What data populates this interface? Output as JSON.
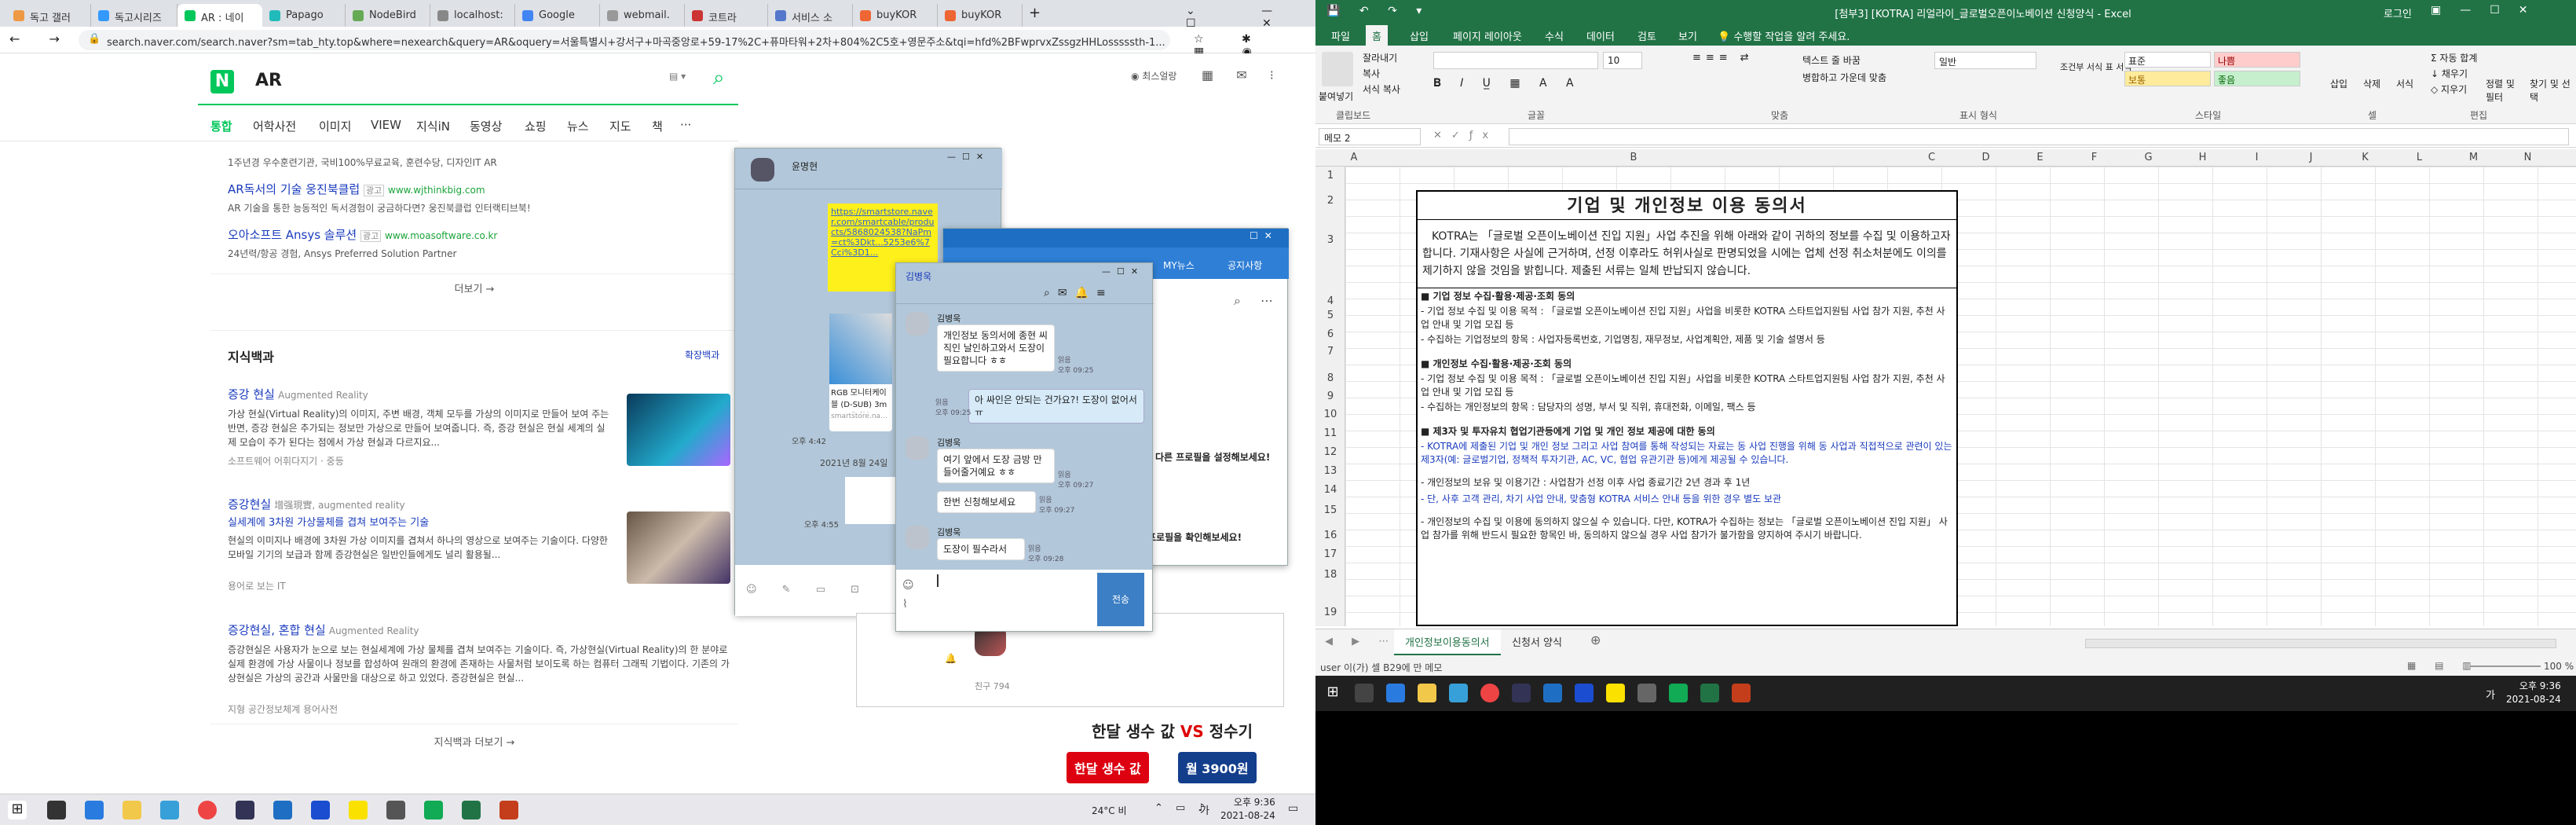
{
  "browser": {
    "tabs": [
      "독고 갤러",
      "독고시리즈",
      "AR : 네이",
      "Papago",
      "NodeBird",
      "localhost:",
      "Google",
      "webmail.",
      "코트라",
      "서비스 소",
      "buyKOR",
      "buyKOR"
    ],
    "url": "search.naver.com/search.naver?sm=tab_hty.top&where=nexearch&query=AR&oquery=서울특별시+강서구+마곡중앙로+59-17%2C+퓨마타워+2차+804%2C5호+영문주소&tqi=hfd%2BFwprvxZssgzHHLosssssth-1..."
  },
  "naver": {
    "logo": "N",
    "query": "AR",
    "user": "최스얼랑",
    "tabs": [
      "통합",
      "어학사전",
      "이미지",
      "VIEW",
      "지식iN",
      "동영상",
      "쇼핑",
      "뉴스",
      "지도",
      "책",
      "···"
    ],
    "ad_top": "1주년경 우수훈련기관, 국비100%무료교육, 훈련수당, 디자인IT AR",
    "ads": [
      {
        "title": "AR독서의 기술 웅진북클럽",
        "badge": "광고",
        "url": "www.wjthinkbig.com",
        "desc": "AR 기술을 통한 능동적인 독서경험이 궁금하다면? 웅진북클럽 인터랙티브북!"
      },
      {
        "title": "오아소프트 Ansys 솔루션",
        "badge": "광고",
        "url": "www.moasoftware.co.kr",
        "desc": "24년력/항공 경험, Ansys Preferred Solution Partner"
      }
    ],
    "more1": "더보기 →",
    "kb_title": "지식백과",
    "kb_expand": "확장백과",
    "kb": [
      {
        "title": "증강 현실",
        "en": "Augmented Reality",
        "text": "가상 현실(Virtual Reality)의 이미지, 주변 배경, 객체 모두를 가상의 이미지로 만들어 보여 주는 반면, 증강 현실은 추가되는 정보만 가상으로 만들어 보여줍니다. 즉, 증강 현실은 현실 세계의 실제 모습이 주가 된다는 점에서 가상 현실과 다르지요...",
        "src": "소프트웨어 어휘다지기 · 중등"
      },
      {
        "title": "증강현실",
        "en": "增强現實, augmented reality",
        "sub": "실세계에 3차원 가상물체를 겹쳐 보여주는 기술",
        "text": "현실의 이미지나 배경에 3차원 가상 이미지를 겹쳐서 하나의 영상으로 보여주는 기술이다. 다양한 모바일 기기의 보급과 함께 증강현실은 일반인들에게도 널리 활용될...",
        "src": "용어로 보는 IT"
      },
      {
        "title": "증강현실, 혼합 현실",
        "en": "Augmented Reality",
        "text": "증강현실은 사용자가 눈으로 보는 현실세계에 가상 물체를 겹쳐 보여주는 기술이다. 즉, 가상현실(Virtual Reality)의 한 분야로 실제 환경에 가상 사물이나 정보를 합성하여 원래의 환경에 존재하는 사물처럼 보이도록 하는 컴퓨터 그래픽 기법이다. 기존의 가상현실은 가상의 공간과 사물만을 대상으로 하고 있었다. 증강현실은 현실...",
        "src": "지형 공간정보체계 용어사전"
      }
    ],
    "more2": "지식백과 더보기 →",
    "ad_banner": {
      "title_a": "한달 생수 값",
      "vs": "VS",
      "title_b": "정수기",
      "btn1": "한달 생수 값",
      "btn2": "월 3900원"
    }
  },
  "kakao_bg": {
    "name": "윤명현",
    "link": "https://smartstore.naver.com/smartcable/products/5868024538?NaPm=ct%3Dkt...5253e6%7Cci%3D1...",
    "t1": "오후 4:42",
    "date": "2021년 8월 24일",
    "t2": "오후 4:55",
    "card": "RGB 모니터케이블 (D-SUB) 3m RGB케이블",
    "card2": "smartstore.naver.com"
  },
  "kakao": {
    "name": "김병욱",
    "msgs": [
      {
        "sender": "김병욱",
        "text": "개인정보 동의서에 종현 씨 직인 날인하고와서 도장이 필요합니다 ㅎㅎ",
        "side": "left",
        "read": "읽음",
        "time": "오후 09:25"
      },
      {
        "text": "아 싸인은 안되는 건가요?! 도장이 없어서 ㅠ",
        "side": "right",
        "read": "읽음",
        "time": "오후 09:25"
      },
      {
        "sender": "김병욱",
        "text": "여기 앞에서 도장 금방 만들어줄거예요 ㅎㅎ",
        "side": "left",
        "read": "읽음",
        "time": "오후 09:27"
      },
      {
        "text": "한번 신청해보세요",
        "side": "left",
        "read": "읽음",
        "time": "오후 09:27"
      },
      {
        "sender": "김병욱",
        "text": "도장이 필수라서",
        "side": "left",
        "read": "읽음",
        "time": "오후 09:28"
      }
    ],
    "send": "전송"
  },
  "kakao_list": {
    "title": "MY뉴스",
    "notice": "공지사항",
    "p1": "다른 프로필을 설정해보세요!",
    "p2": "프로필을 확인해보세요!",
    "friend": "친구 794"
  },
  "tray_left": {
    "weather": "24°C 비",
    "ime": "가",
    "time": "오후 9:36",
    "date": "2021-08-24"
  },
  "excel": {
    "title": "[첨부3] [KOTRA] 리얼라이_글로벌오픈이노베이션 신청양식 - Excel",
    "user": "로그인",
    "tabs": [
      "파일",
      "홈",
      "삽입",
      "페이지 레이아웃",
      "수식",
      "데이터",
      "검토",
      "보기",
      "수행할 작업을 알려 주세요."
    ],
    "namebox": "메모 2",
    "font_size": "10",
    "groups": [
      "클립보드",
      "글꼴",
      "맞춤",
      "표시 형식",
      "스타일",
      "셀",
      "편집"
    ],
    "ribbon_btns": [
      "붙여넣기",
      "잘라내기",
      "복사",
      "서식 복사",
      "텍스트 줄 바꿈",
      "병합하고 가운데 맞춤",
      "일반",
      "조건부 서식",
      "표 서식",
      "표준",
      "나쁨",
      "보통",
      "좋음",
      "삽입",
      "삭제",
      "서식",
      "자동 합계",
      "채우기",
      "지우기",
      "정렬 및 필터",
      "찾기 및 선택"
    ],
    "cols": [
      "A",
      "B",
      "C",
      "D",
      "E",
      "F",
      "G",
      "H",
      "I",
      "J",
      "K",
      "L",
      "M",
      "N"
    ],
    "rows": [
      "1",
      "2",
      "3",
      "4",
      "5",
      "6",
      "7",
      "8",
      "9",
      "10",
      "11",
      "12",
      "13",
      "14",
      "15",
      "16",
      "17",
      "18",
      "19"
    ],
    "doc": {
      "title": "기업 및 개인정보 이용 동의서",
      "intro": "KOTRA는 「글로벌 오픈이노베이션 진입 지원」사업 추진을 위해 아래와 같이 귀하의 정보를 수집 및 이용하고자 합니다. 기재사항은 사실에 근거하며, 선정 이후라도 허위사실로 판명되었을 시에는 업체 선정 취소처분에도 이의를 제기하지 않을 것임을 밝힙니다. 제출된 서류는 일체 반납되지 않습니다.",
      "s1": "■ 기업 정보 수집·활용·제공·조회 동의",
      "s1a": "- 기업 정보 수집 및 이용 목적 : 「글로벌 오픈이노베이션 진입 지원」사업을 비롯한 KOTRA 스타트업지원팀 사업 참가 지원, 추천 사업 안내 및 기업 모집 등",
      "s1b": "- 수집하는 기업정보의 항목 : 사업자등록번호, 기업명칭, 재무정보, 사업계획안, 제품 및 기술 설명서 등",
      "s2": "■ 개인정보 수집·활용·제공·조회 동의",
      "s2a": "- 기업 정보 수집 및 이용 목적 : 「글로벌 오픈이노베이션 진입 지원」사업을 비롯한 KOTRA 스타트업지원팀 사업 참가 지원, 추천 사업 안내 및 기업 모집 등",
      "s2b": "- 수집하는 개인정보의 항목 : 담당자의 성명, 부서 및 직위, 휴대전화, 이메일, 팩스 등",
      "s3": "■ 제3자 및 투자유치 협업기관등에게 기업 및 개인 정보 제공에 대한 동의",
      "s3a": "- KOTRA에 제출된 기업 및 개인 정보 그리고 사업 참여를 통해 작성되는 자료는 동 사업 진행을 위해 동 사업과 직접적으로 관련이 있는 제3자(예: 글로벌기업, 정책적 투자기관, AC, VC, 협업 유관기관 등)에게 제공될 수 있습니다.",
      "s4a": "- 개인정보의 보유 및 이용기간 : 사업참가 선정 이후 사업 종료기간 2년 경과 후 1년",
      "s4b": "- 단, 사후 고객 관리, 차기 사업 안내, 맞춤형 KOTRA 서비스 안내 등을 위한 경우 별도 보관",
      "s5": "- 개인정보의 수집 및 이용에 동의하지 않으실 수 있습니다. 다만, KOTRA가 수집하는 정보는 「글로벌 오픈이노베이션 진입 지원」 사업 참가를 위해 반드시 필요한 항목인 바, 동의하지 않으실 경우 사업 참가가 불가함을 양지하여 주시기 바랍니다."
    },
    "sheets": [
      "개인정보이용동의서",
      "신청서 양식"
    ],
    "status": "user 이(가) 셀 B29에 만 메모",
    "zoom": "100 %",
    "tray": {
      "ime": "가",
      "time": "오후 9:36",
      "date": "2021-08-24"
    }
  },
  "colors": {
    "naver": "#03c75a",
    "excel": "#217346",
    "kakao_bg": "#b2c7d9",
    "link": "#1a3bbd"
  }
}
